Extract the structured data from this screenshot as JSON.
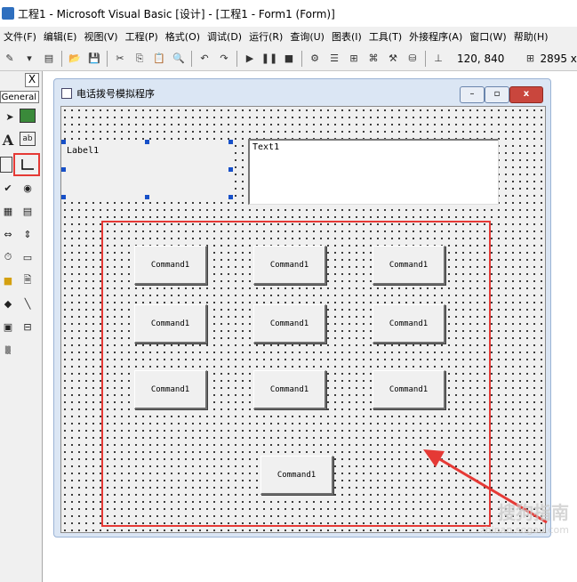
{
  "window": {
    "title": "工程1 - Microsoft Visual Basic [设计] - [工程1 - Form1 (Form)]"
  },
  "menu": {
    "items": [
      {
        "label": "文件(F)"
      },
      {
        "label": "编辑(E)"
      },
      {
        "label": "视图(V)"
      },
      {
        "label": "工程(P)"
      },
      {
        "label": "格式(O)"
      },
      {
        "label": "调试(D)"
      },
      {
        "label": "运行(R)"
      },
      {
        "label": "查询(U)"
      },
      {
        "label": "图表(I)"
      },
      {
        "label": "工具(T)"
      },
      {
        "label": "外接程序(A)"
      },
      {
        "label": "窗口(W)"
      },
      {
        "label": "帮助(H)"
      }
    ]
  },
  "toolbar": {
    "position": "120, 840",
    "size": "2895 x"
  },
  "toolbox": {
    "close_glyph": "X",
    "header": "General"
  },
  "form": {
    "title": "电话拨号模拟程序",
    "min_glyph": "–",
    "max_glyph": "▫",
    "close_glyph": "x",
    "label1": "Label1",
    "text1": "Text1",
    "command_label": "Command1"
  },
  "annotation": {
    "highlight_color": "#e53935"
  },
  "watermark": {
    "text": "搜狗指南",
    "sub": "zhinan.sogou.com"
  }
}
